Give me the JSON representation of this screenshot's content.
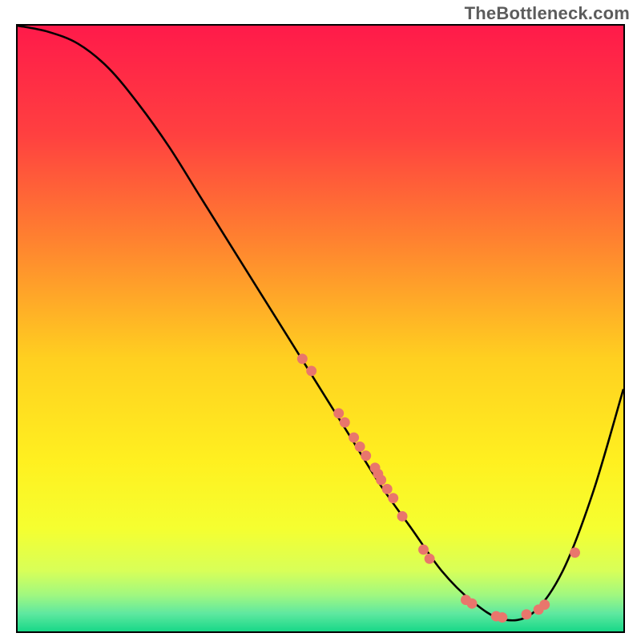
{
  "watermark": "TheBottleneck.com",
  "chart_data": {
    "type": "line",
    "title": "",
    "xlabel": "",
    "ylabel": "",
    "xlim": [
      0,
      100
    ],
    "ylim": [
      0,
      100
    ],
    "grid": false,
    "legend": false,
    "series": [
      {
        "name": "bottleneck-curve",
        "x": [
          0,
          5,
          10,
          15,
          20,
          25,
          30,
          35,
          40,
          45,
          50,
          55,
          60,
          65,
          70,
          75,
          80,
          85,
          90,
          95,
          100
        ],
        "y": [
          100,
          99,
          97,
          93,
          87,
          80,
          72,
          64,
          56,
          48,
          40,
          32,
          24,
          17,
          10,
          5,
          2,
          3,
          10,
          23,
          40
        ],
        "color": "#000000"
      }
    ],
    "scatter": [
      {
        "name": "highlight-points",
        "color": "#e9766c",
        "points": [
          {
            "x": 47,
            "y": 45
          },
          {
            "x": 48.5,
            "y": 43
          },
          {
            "x": 53,
            "y": 36
          },
          {
            "x": 54,
            "y": 34.5
          },
          {
            "x": 55.5,
            "y": 32
          },
          {
            "x": 56.5,
            "y": 30.5
          },
          {
            "x": 57.5,
            "y": 29
          },
          {
            "x": 59,
            "y": 27
          },
          {
            "x": 59.5,
            "y": 26
          },
          {
            "x": 60,
            "y": 25
          },
          {
            "x": 61,
            "y": 23.5
          },
          {
            "x": 62,
            "y": 22
          },
          {
            "x": 63.5,
            "y": 19
          },
          {
            "x": 67,
            "y": 13.5
          },
          {
            "x": 68,
            "y": 12
          },
          {
            "x": 74,
            "y": 5.2
          },
          {
            "x": 75,
            "y": 4.6
          },
          {
            "x": 79,
            "y": 2.5
          },
          {
            "x": 80,
            "y": 2.3
          },
          {
            "x": 84,
            "y": 2.8
          },
          {
            "x": 86,
            "y": 3.6
          },
          {
            "x": 87,
            "y": 4.4
          },
          {
            "x": 92,
            "y": 13
          }
        ]
      }
    ],
    "background_gradient": {
      "type": "vertical",
      "stops": [
        {
          "pos": 0.0,
          "color": "#ff1a4a"
        },
        {
          "pos": 0.18,
          "color": "#ff4040"
        },
        {
          "pos": 0.35,
          "color": "#ff8030"
        },
        {
          "pos": 0.55,
          "color": "#ffd020"
        },
        {
          "pos": 0.72,
          "color": "#fff020"
        },
        {
          "pos": 0.83,
          "color": "#f5ff30"
        },
        {
          "pos": 0.9,
          "color": "#d8ff58"
        },
        {
          "pos": 0.94,
          "color": "#a0f880"
        },
        {
          "pos": 0.97,
          "color": "#60e8a0"
        },
        {
          "pos": 1.0,
          "color": "#18d888"
        }
      ]
    }
  }
}
